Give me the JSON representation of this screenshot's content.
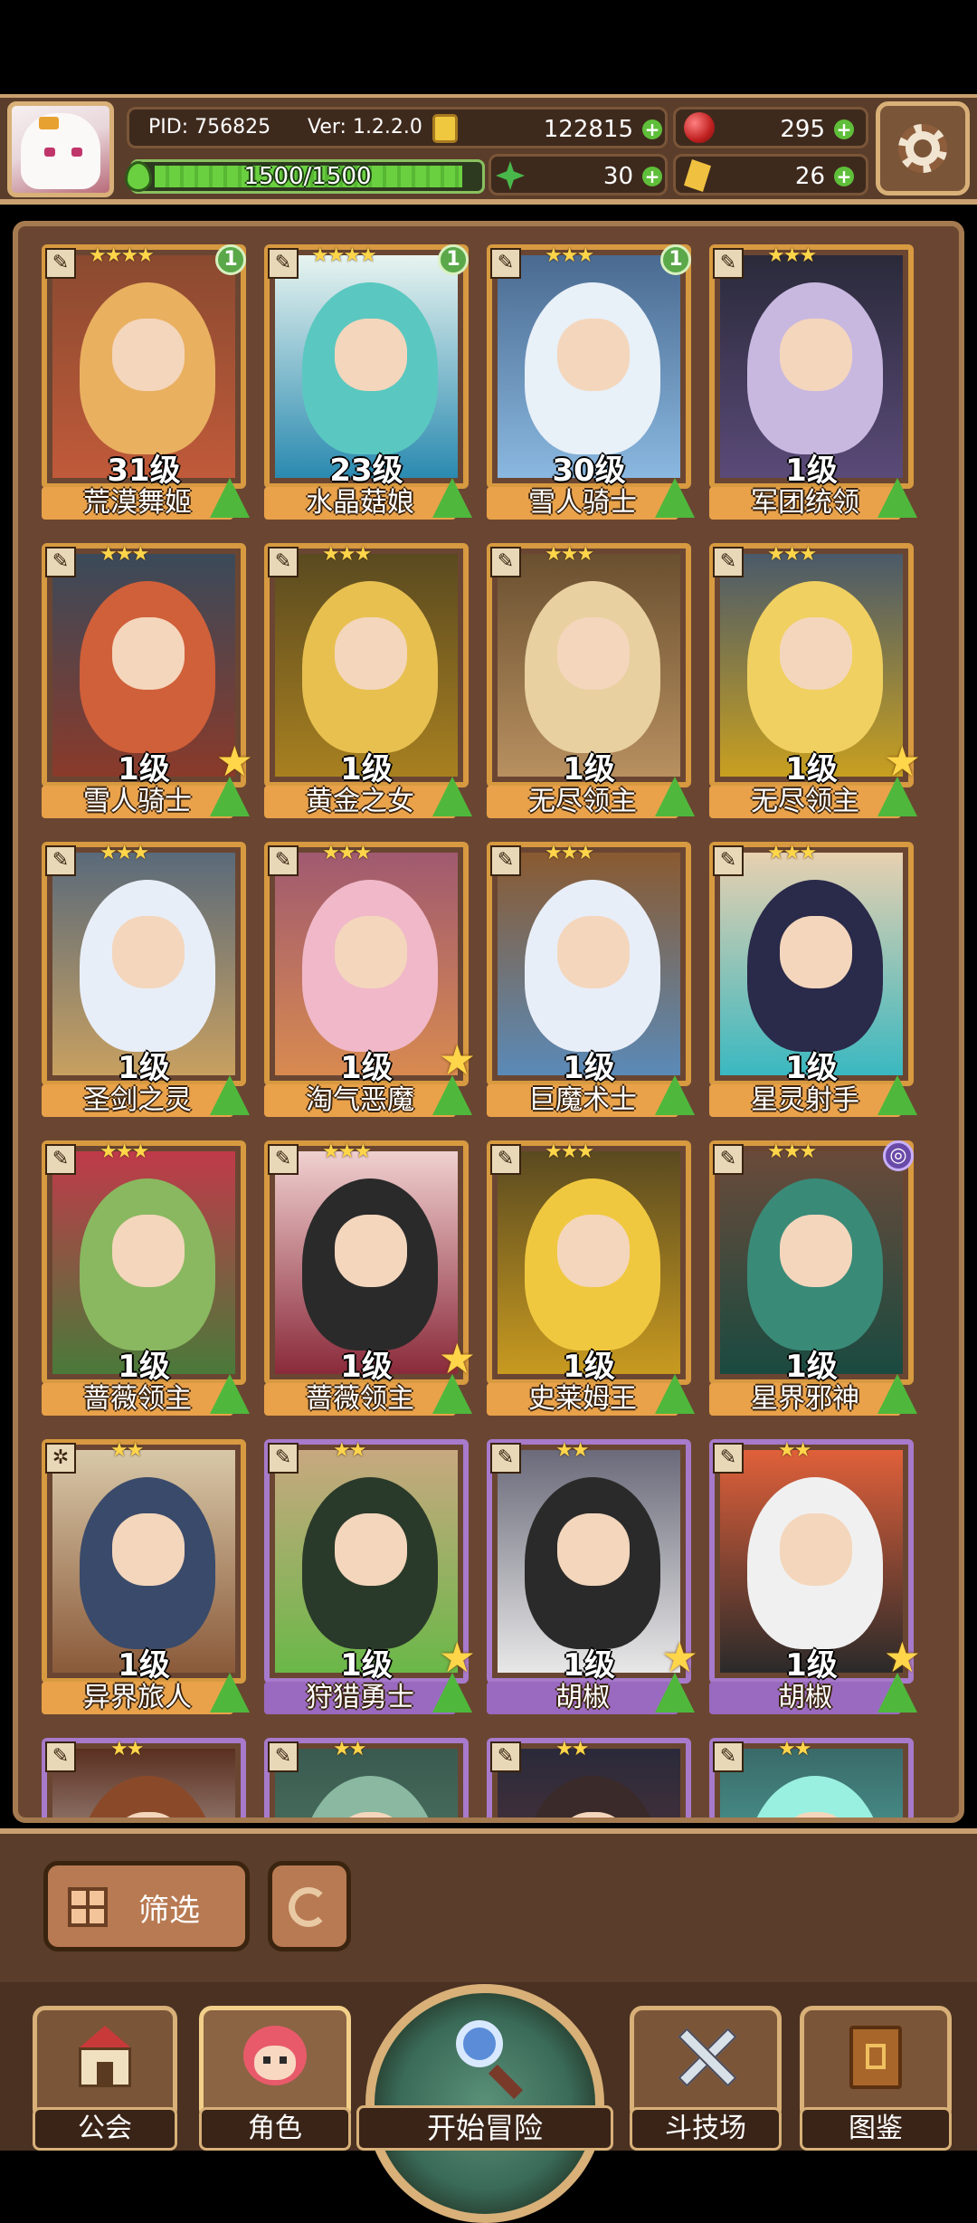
{
  "header": {
    "pid": "PID: 756825",
    "version": "Ver: 1.2.2.0",
    "gold": "122815",
    "gems": "295",
    "energy": "1500/1500",
    "energy_fraction": 1.0,
    "clover": "30",
    "crystal": "26"
  },
  "cards": [
    {
      "name": "荒漠舞姬",
      "level": "31级",
      "stars": "★★★★",
      "badge": "1",
      "purple": false,
      "up": true,
      "star": false,
      "tag": "✎",
      "colors": [
        "#e9b060",
        "#c05a3a",
        "#8a4a30"
      ]
    },
    {
      "name": "水晶菇娘",
      "level": "23级",
      "stars": "★★★★",
      "badge": "1",
      "purple": false,
      "up": true,
      "star": false,
      "tag": "✎",
      "colors": [
        "#5ac8c0",
        "#2a8ab0",
        "#e8f4f0"
      ]
    },
    {
      "name": "雪人骑士",
      "level": "30级",
      "stars": "★★★",
      "badge": "1",
      "purple": false,
      "up": true,
      "star": false,
      "tag": "✎",
      "colors": [
        "#e8f0f8",
        "#8ab8e0",
        "#4a6a90"
      ]
    },
    {
      "name": "军团统领",
      "level": "1级",
      "stars": "★★★",
      "badge": "",
      "purple": false,
      "up": true,
      "star": false,
      "tag": "✎",
      "colors": [
        "#c8b8e0",
        "#5a4a78",
        "#2a2a3a"
      ]
    },
    {
      "name": "雪人骑士",
      "level": "1级",
      "stars": "★★★",
      "badge": "",
      "purple": false,
      "up": true,
      "star": true,
      "tag": "✎",
      "colors": [
        "#d0603a",
        "#8a3a2a",
        "#3a4a5a"
      ]
    },
    {
      "name": "黄金之女",
      "level": "1级",
      "stars": "★★★",
      "badge": "",
      "purple": false,
      "up": true,
      "star": false,
      "tag": "✎",
      "colors": [
        "#e8c050",
        "#a88020",
        "#5a4a20"
      ]
    },
    {
      "name": "无尽领主",
      "level": "1级",
      "stars": "★★★",
      "badge": "",
      "purple": false,
      "up": true,
      "star": false,
      "tag": "✎",
      "colors": [
        "#e8d0a0",
        "#b89060",
        "#6a5030"
      ]
    },
    {
      "name": "无尽领主",
      "level": "1级",
      "stars": "★★★",
      "badge": "",
      "purple": false,
      "up": true,
      "star": true,
      "tag": "✎",
      "colors": [
        "#f0d060",
        "#c8a020",
        "#4a5a6a"
      ]
    },
    {
      "name": "圣剑之灵",
      "level": "1级",
      "stars": "★★★",
      "badge": "",
      "purple": false,
      "up": true,
      "star": false,
      "tag": "✎",
      "colors": [
        "#e8eef8",
        "#c8a060",
        "#5a6a7a"
      ]
    },
    {
      "name": "淘气恶魔",
      "level": "1级",
      "stars": "★★★",
      "badge": "",
      "purple": false,
      "up": true,
      "star": true,
      "tag": "✎",
      "colors": [
        "#f0b8c8",
        "#d88a50",
        "#a05a70"
      ]
    },
    {
      "name": "巨魔术士",
      "level": "1级",
      "stars": "★★★",
      "badge": "",
      "purple": false,
      "up": true,
      "star": false,
      "tag": "✎",
      "colors": [
        "#e8eef8",
        "#5a8ab8",
        "#8a5a30"
      ]
    },
    {
      "name": "星灵射手",
      "level": "1级",
      "stars": "★★★",
      "badge": "",
      "purple": false,
      "up": true,
      "star": false,
      "tag": "✎",
      "colors": [
        "#2a2a4a",
        "#3ab8c0",
        "#e8d0b0"
      ]
    },
    {
      "name": "蔷薇领主",
      "level": "1级",
      "stars": "★★★",
      "badge": "",
      "purple": false,
      "up": true,
      "star": false,
      "tag": "✎",
      "colors": [
        "#8ab860",
        "#4a7a3a",
        "#c03a4a"
      ]
    },
    {
      "name": "蔷薇领主",
      "level": "1级",
      "stars": "★★★",
      "badge": "",
      "purple": false,
      "up": true,
      "star": true,
      "tag": "✎",
      "colors": [
        "#2a2a2a",
        "#8a2a3a",
        "#f0d0d0"
      ]
    },
    {
      "name": "史莱姆王",
      "level": "1级",
      "stars": "★★★",
      "badge": "",
      "purple": false,
      "up": true,
      "star": false,
      "tag": "✎",
      "colors": [
        "#f0c840",
        "#c89a20",
        "#5a4a20"
      ]
    },
    {
      "name": "星界邪神",
      "level": "1级",
      "stars": "★★★",
      "badge": "◎",
      "purple": false,
      "up": true,
      "star": false,
      "tag": "✎",
      "colors": [
        "#3a8a78",
        "#1a4a40",
        "#6a4a3a"
      ]
    },
    {
      "name": "异界旅人",
      "level": "1级",
      "stars": "★★",
      "badge": "",
      "purple": false,
      "up": true,
      "star": false,
      "tag": "✲",
      "colors": [
        "#3a4a6a",
        "#8a5a3a",
        "#d8c8a8"
      ]
    },
    {
      "name": "狩猎勇士",
      "level": "1级",
      "stars": "★★",
      "badge": "",
      "purple": true,
      "up": true,
      "star": true,
      "tag": "✎",
      "colors": [
        "#2a3a2a",
        "#6ab848",
        "#c8a880"
      ]
    },
    {
      "name": "胡椒",
      "level": "1级",
      "stars": "★★",
      "badge": "",
      "purple": true,
      "up": true,
      "star": true,
      "tag": "✎",
      "colors": [
        "#2a2a2a",
        "#e8e8e8",
        "#6a6a7a"
      ]
    },
    {
      "name": "胡椒",
      "level": "1级",
      "stars": "★★",
      "badge": "",
      "purple": true,
      "up": true,
      "star": true,
      "tag": "✎",
      "colors": [
        "#f0f0f0",
        "#2a2a2a",
        "#e0603a"
      ]
    },
    {
      "name": "",
      "level": "",
      "stars": "★★",
      "badge": "",
      "purple": true,
      "up": false,
      "star": false,
      "tag": "✎",
      "colors": [
        "#8a4a2a",
        "#f0f0f0",
        "#5a3020"
      ]
    },
    {
      "name": "",
      "level": "",
      "stars": "★★",
      "badge": "",
      "purple": true,
      "up": false,
      "star": false,
      "tag": "✎",
      "colors": [
        "#8ab8a0",
        "#5a8a70",
        "#3a5a50"
      ]
    },
    {
      "name": "",
      "level": "",
      "stars": "★★",
      "badge": "",
      "purple": true,
      "up": false,
      "star": false,
      "tag": "✎",
      "colors": [
        "#3a2a2a",
        "#6a3a3a",
        "#2a2a3a"
      ]
    },
    {
      "name": "",
      "level": "",
      "stars": "★★",
      "badge": "",
      "purple": true,
      "up": false,
      "star": false,
      "tag": "✎",
      "colors": [
        "#9af0e0",
        "#5ac8b8",
        "#3a6a6a"
      ]
    }
  ],
  "filter": {
    "label": "筛选"
  },
  "nav": {
    "guild": "公会",
    "character": "角色",
    "adventure": "开始冒险",
    "arena": "斗技场",
    "codex": "图鉴"
  }
}
